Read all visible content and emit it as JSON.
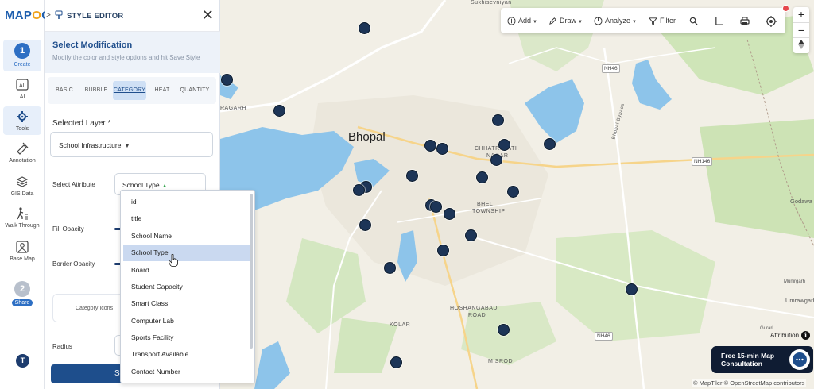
{
  "app": {
    "logo_text_pre": "MAP",
    "logo_text_o": "O",
    "logo_text_post": "G"
  },
  "rail": {
    "step1": {
      "number": "1",
      "label": "Create"
    },
    "items": [
      {
        "label": "AI",
        "icon": "ai-icon"
      },
      {
        "label": "Tools",
        "icon": "tools-icon"
      },
      {
        "label": "Annotation",
        "icon": "annotation-icon"
      },
      {
        "label": "GIS Data",
        "icon": "layers-icon"
      },
      {
        "label": "Walk Through",
        "icon": "walk-icon"
      },
      {
        "label": "Base Map",
        "icon": "basemap-icon"
      }
    ],
    "step2": {
      "number": "2",
      "label": "Share"
    },
    "avatar_initial": "T"
  },
  "panel": {
    "expand_glyph": ">",
    "title": "STYLE EDITOR",
    "close_glyph": "✕",
    "heading": "Select Modification",
    "subheading": "Modify the color and style options and hit Save Style",
    "tabs": [
      "BASIC",
      "BUBBLE",
      "CATEGORY",
      "HEAT",
      "QUANTITY"
    ],
    "active_tab": "CATEGORY",
    "selected_layer_label": "Selected Layer *",
    "selected_layer_value": "School Infrastructure",
    "select_attribute_label": "Select Attribute",
    "select_attribute_value": "School Type",
    "fill_opacity_label": "Fill Opacity",
    "border_opacity_label": "Border Opacity",
    "category_icons_label": "Category Icons",
    "radius_label": "Radius",
    "save_label": "Sa"
  },
  "dropdown": {
    "options": [
      "id",
      "title",
      "School Name",
      "School Type",
      "Board",
      "Student Capacity",
      "Smart Class",
      "Computer Lab",
      "Sports Facility",
      "Transport Available",
      "Contact Number"
    ],
    "highlighted": "School Type"
  },
  "toolbar": {
    "add": "Add",
    "draw": "Draw",
    "analyze": "Analyze",
    "filter": "Filter"
  },
  "zoom": {
    "in": "+",
    "out": "−"
  },
  "map": {
    "city": "Bhopal",
    "labels": {
      "top": "Sukhisevniyan",
      "left": "RAGARH",
      "chhatrapati": "CHHATRAPATI",
      "nagar": "NAGAR",
      "bhel1": "BHEL",
      "bhel2": "TOWNSHIP",
      "hosh1": "HOSHANGABAD",
      "hosh2": "ROAD",
      "kolar": "KOLAR",
      "misrod": "MISROD",
      "bypass": "Bhopal Bypass",
      "godawa": "Godawa",
      "munirgarh": "Munirgarh",
      "umrawgan": "Umrawgarh",
      "gurari": "Gurari"
    },
    "shields": {
      "nh46a": "NH46",
      "nh146": "NH146",
      "nh46b": "NH46"
    }
  },
  "consult": {
    "line1": "Free 15-min Map",
    "line2": "Consultation"
  },
  "attribution": "Attribution",
  "copyright": "© MapTiler © OpenStreetMap contributors",
  "colors": {
    "accent": "#1f4e8c",
    "marker": "#1d3557",
    "water": "#8dc4ea",
    "park": "#c9e4b4"
  }
}
